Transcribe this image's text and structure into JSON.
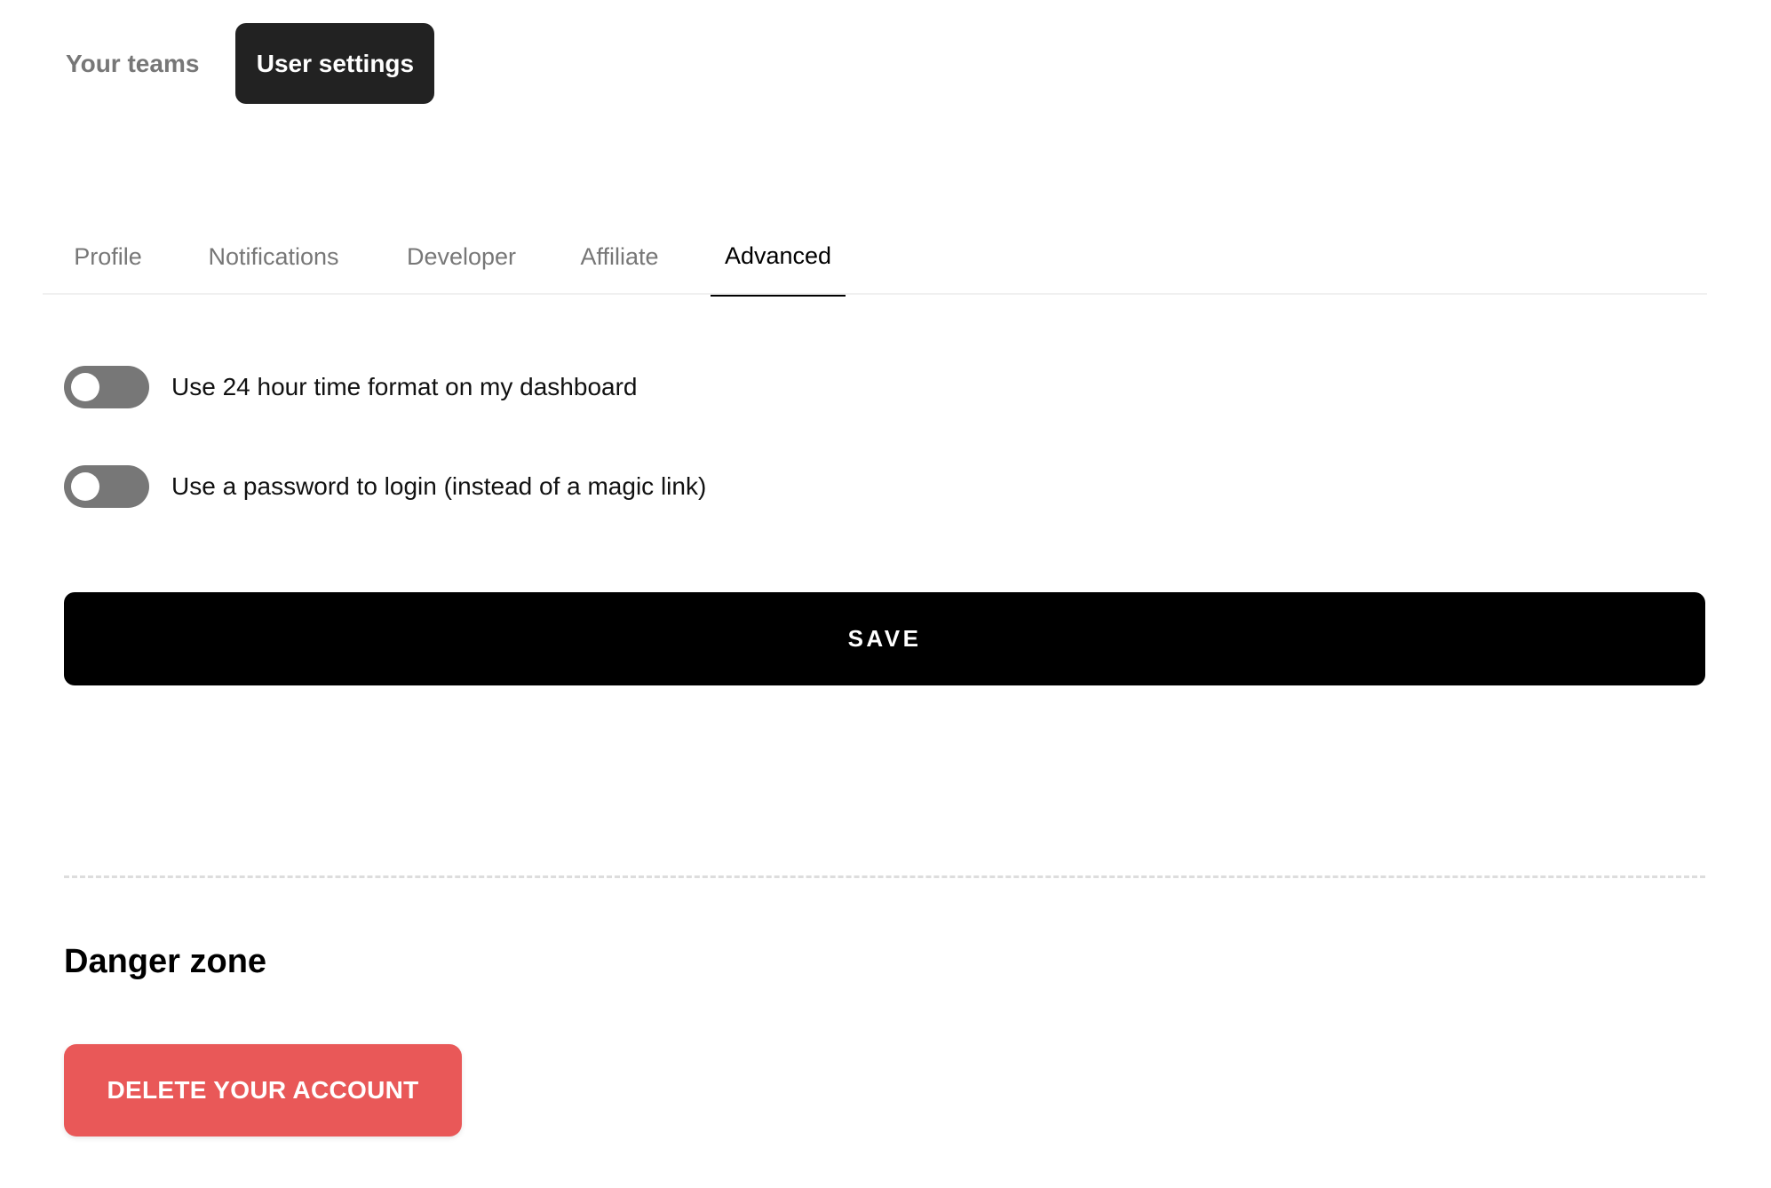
{
  "top_nav": {
    "items": [
      {
        "label": "Your teams",
        "active": false
      },
      {
        "label": "User settings",
        "active": true
      }
    ]
  },
  "tabs": [
    {
      "label": "Profile",
      "active": false
    },
    {
      "label": "Notifications",
      "active": false
    },
    {
      "label": "Developer",
      "active": false
    },
    {
      "label": "Affiliate",
      "active": false
    },
    {
      "label": "Advanced",
      "active": true
    }
  ],
  "settings": {
    "toggles": [
      {
        "label": "Use 24 hour time format on my dashboard",
        "enabled": false
      },
      {
        "label": "Use a password to login (instead of a magic link)",
        "enabled": false
      }
    ],
    "save_label": "SAVE"
  },
  "danger_zone": {
    "title": "Danger zone",
    "delete_label": "DELETE YOUR ACCOUNT"
  },
  "colors": {
    "active_nav_bg": "#222222",
    "toggle_off": "#777777",
    "save_bg": "#000000",
    "danger": "#e95858",
    "inactive_text": "#777777"
  }
}
